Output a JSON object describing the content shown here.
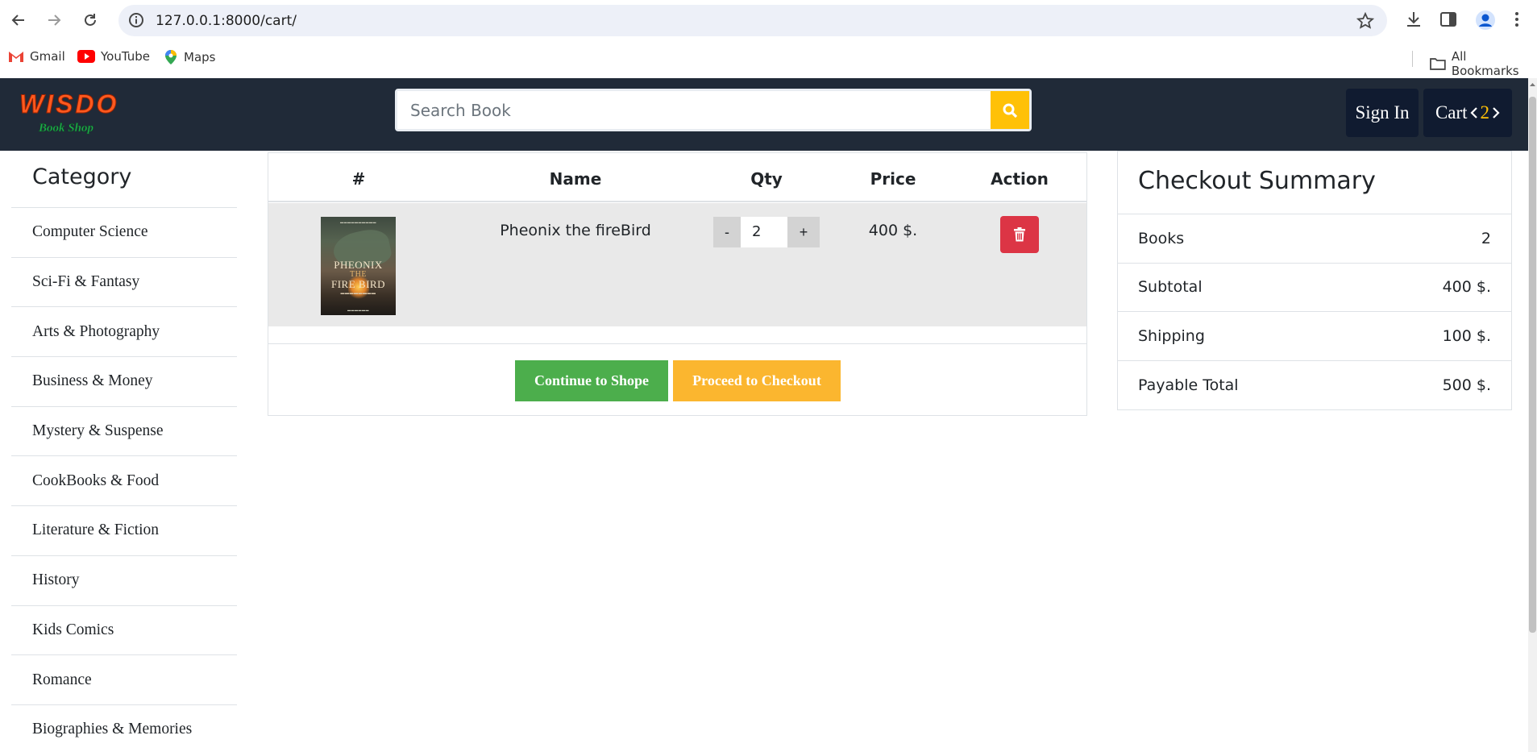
{
  "browser": {
    "url": "127.0.0.1:8000/cart/",
    "bookmarks": [
      {
        "label": "Gmail",
        "icon": "gmail-icon"
      },
      {
        "label": "YouTube",
        "icon": "youtube-icon"
      },
      {
        "label": "Maps",
        "icon": "maps-icon"
      }
    ],
    "all_bookmarks": "All Bookmarks"
  },
  "header": {
    "logo_text": "WISDO",
    "logo_subtext": "Book Shop",
    "search_placeholder": "Search Book",
    "signin_label": "Sign In",
    "cart_label": "Cart",
    "cart_count": "2",
    "accent_color": "#ffc107",
    "nav_bg": "#202a38"
  },
  "sidebar": {
    "title": "Category",
    "items": [
      "Computer Science",
      "Sci-Fi & Fantasy",
      "Arts & Photography",
      "Business & Money",
      "Mystery & Suspense",
      "CookBooks & Food",
      "Literature & Fiction",
      "History",
      "Kids Comics",
      "Romance",
      "Biographies & Memories"
    ]
  },
  "cart_table": {
    "headers": [
      "#",
      "Name",
      "Qty",
      "Price",
      "Action"
    ],
    "rows": [
      {
        "cover_title_1": "PHEONIX",
        "cover_title_2": "THE",
        "cover_title_3": "FIRE BIRD",
        "name": "Pheonix the fireBird",
        "qty_minus": "-",
        "qty": "2",
        "qty_plus": "+",
        "price": "400 $."
      }
    ],
    "continue_label": "Continue to Shope",
    "checkout_label": "Proceed to Checkout"
  },
  "summary": {
    "title": "Checkout Summary",
    "rows": [
      {
        "label": "Books",
        "value": "2"
      },
      {
        "label": "Subtotal",
        "value": "400 $."
      },
      {
        "label": "Shipping",
        "value": "100 $."
      },
      {
        "label": "Payable Total",
        "value": "500 $."
      }
    ]
  }
}
